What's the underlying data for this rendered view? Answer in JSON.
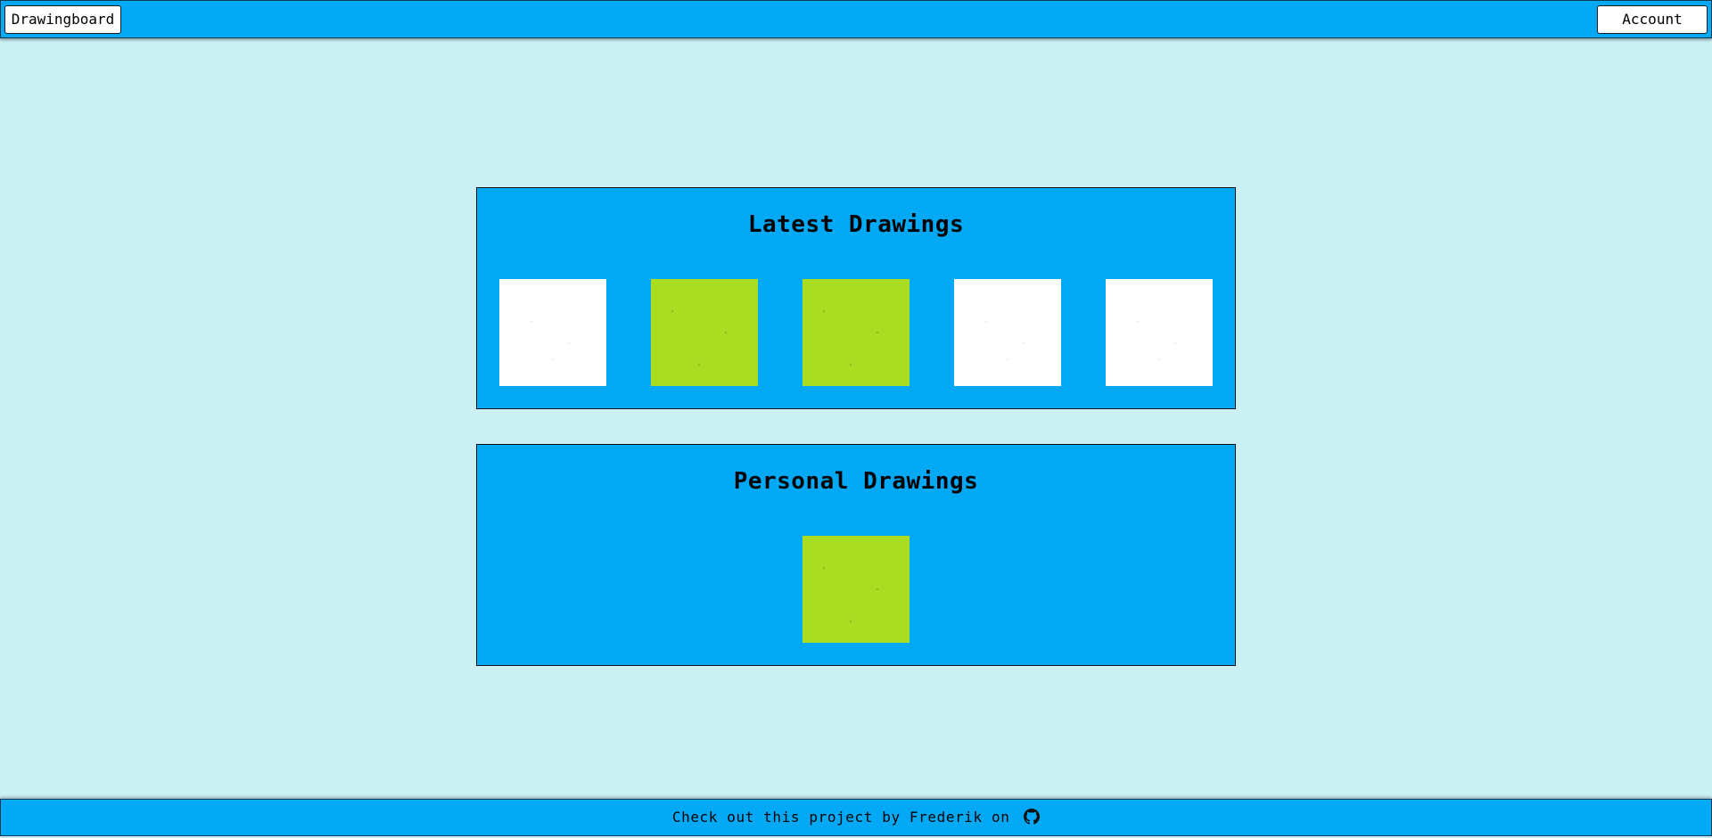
{
  "navbar": {
    "home_label": "Drawingboard",
    "account_label": "Account"
  },
  "latest": {
    "title": "Latest Drawings",
    "drawings": [
      {
        "color": "#ffffff"
      },
      {
        "color": "#aadc22"
      },
      {
        "color": "#aadc22"
      },
      {
        "color": "#ffffff"
      },
      {
        "color": "#ffffff"
      }
    ]
  },
  "personal": {
    "title": "Personal Drawings",
    "drawings": [
      {
        "color": "#aadc22"
      }
    ]
  },
  "footer": {
    "text": "Check out this project by Frederik on",
    "icon": "github-icon"
  },
  "colors": {
    "background": "#cbf1f5",
    "accent": "#03a9f4",
    "drawing_green": "#aadc22"
  }
}
